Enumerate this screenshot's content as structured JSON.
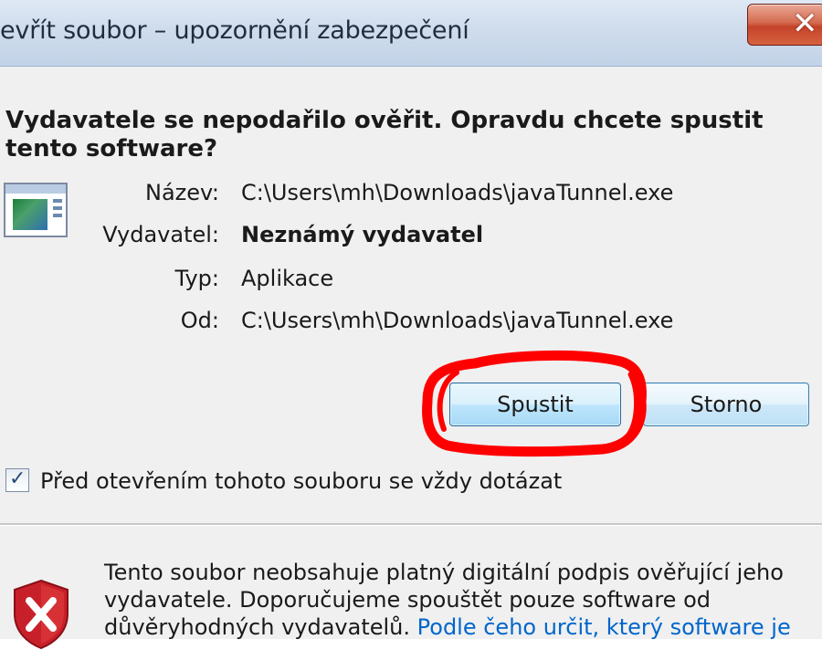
{
  "window": {
    "title": "evřít soubor – upozornění zabezpečení",
    "close_glyph": "✕"
  },
  "dialog": {
    "question": "Vydavatele se nepodařilo ověřit. Opravdu chcete spustit tento software?",
    "icon": "application-icon",
    "fields": [
      {
        "label": "Název:",
        "value": "C:\\Users\\mh\\Downloads\\javaTunnel.exe",
        "bold": false
      },
      {
        "label": "Vydavatel:",
        "value": "Neznámý vydavatel",
        "bold": true
      },
      {
        "label": "Typ:",
        "value": "Aplikace",
        "bold": false
      },
      {
        "label": "Od:",
        "value": "C:\\Users\\mh\\Downloads\\javaTunnel.exe",
        "bold": false
      }
    ],
    "buttons": {
      "run_label": "Spustit",
      "cancel_label": "Storno"
    },
    "checkbox": {
      "checked": true,
      "label": "Před otevřením tohoto souboru se vždy dotázat"
    },
    "footer": {
      "text": "Tento soubor neobsahuje platný digitální podpis ověřující jeho vydavatele. Doporučujeme spouštět pouze software od důvěryhodných vydavatelů. ",
      "link": "Podle čeho určit, který software je",
      "icon": "shield-error-icon"
    }
  },
  "colors": {
    "annotation": "#ff0000",
    "link": "#0066cc",
    "shield": "#c8202a"
  }
}
